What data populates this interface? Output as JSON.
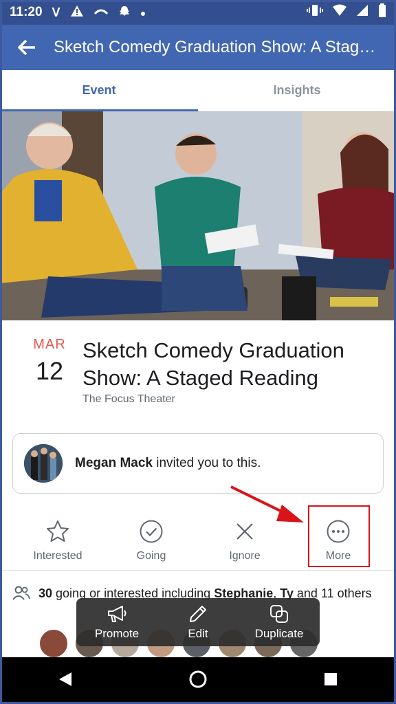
{
  "status_bar": {
    "time": "11:20",
    "icons": [
      "v-icon",
      "warning-icon",
      "wave-icon",
      "snapchat-icon",
      "dot-icon",
      "vibrate-icon",
      "wifi-icon",
      "signal-icon",
      "battery-icon"
    ]
  },
  "app_bar": {
    "title": "Sketch Comedy Graduation Show: A Staged Reading"
  },
  "tabs": [
    {
      "label": "Event",
      "active": true
    },
    {
      "label": "Insights",
      "active": false
    }
  ],
  "event": {
    "month": "MAR",
    "day": "12",
    "title": "Sketch Comedy Graduation Show: A Staged Reading",
    "venue": "The Focus Theater"
  },
  "invite": {
    "name": "Megan Mack",
    "text": " invited you to this."
  },
  "actions": [
    {
      "label": "Interested",
      "icon": "star-icon"
    },
    {
      "label": "Going",
      "icon": "check-circle-icon"
    },
    {
      "label": "Ignore",
      "icon": "close-icon"
    },
    {
      "label": "More",
      "icon": "more-icon"
    }
  ],
  "going": {
    "count": "30",
    "text1": " going or interested including ",
    "name1": "Stephanie",
    "sep": ", ",
    "name2": "Ty",
    "text2": " and 11 others"
  },
  "toast": [
    {
      "label": "Promote",
      "icon": "megaphone-icon"
    },
    {
      "label": "Edit",
      "icon": "pencil-icon"
    },
    {
      "label": "Duplicate",
      "icon": "duplicate-icon"
    }
  ],
  "colors": {
    "brand": "#4267b2",
    "status_bar": "#344f8f",
    "month": "#e4574f",
    "highlight": "#d8141a"
  }
}
